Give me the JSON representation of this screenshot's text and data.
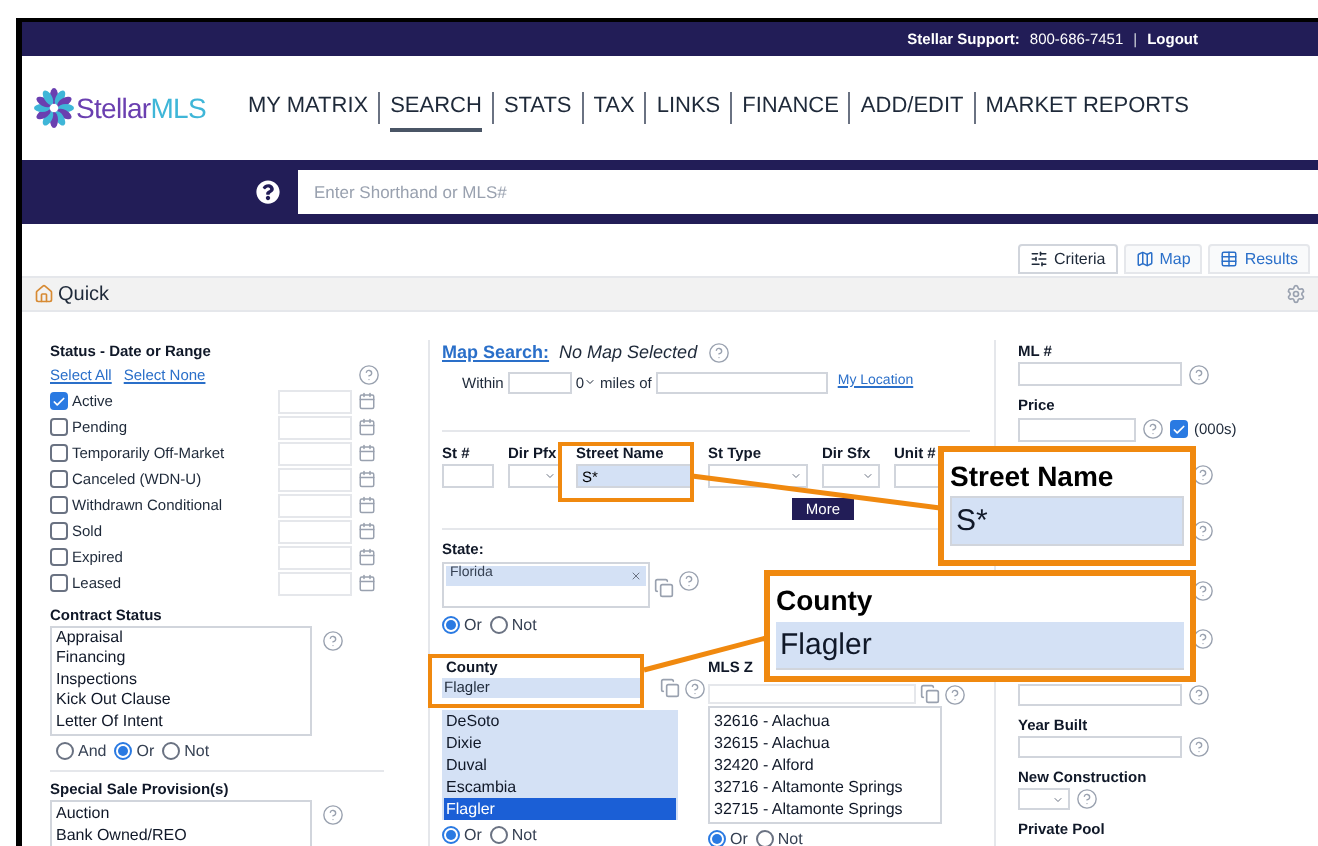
{
  "top_bar": {
    "support_label": "Stellar Support:",
    "phone": "800-686-7451",
    "separator": "|",
    "logout": "Logout"
  },
  "logo": {
    "part_1": "Stellar",
    "part_2": "MLS"
  },
  "nav": [
    {
      "label": "MY MATRIX",
      "selected": false
    },
    {
      "label": "SEARCH",
      "selected": true
    },
    {
      "label": "STATS",
      "selected": false
    },
    {
      "label": "TAX",
      "selected": false
    },
    {
      "label": "LINKS",
      "selected": false
    },
    {
      "label": "FINANCE",
      "selected": false
    },
    {
      "label": "ADD/EDIT",
      "selected": false
    },
    {
      "label": "MARKET REPORTS",
      "selected": false
    }
  ],
  "shorthand": {
    "placeholder": "Enter Shorthand or MLS#"
  },
  "view_tabs": [
    {
      "label": "Criteria",
      "selected": true
    },
    {
      "label": "Map",
      "selected": false
    },
    {
      "label": "Results",
      "selected": false
    }
  ],
  "panel": {
    "title": "Quick"
  },
  "status": {
    "title": "Status - Date or Range",
    "select_all": "Select All",
    "select_none": "Select None",
    "items": [
      {
        "label": "Active",
        "checked": true
      },
      {
        "label": "Pending",
        "checked": false
      },
      {
        "label": "Temporarily Off-Market",
        "checked": false
      },
      {
        "label": "Canceled (WDN-U)",
        "checked": false
      },
      {
        "label": "Withdrawn Conditional",
        "checked": false
      },
      {
        "label": "Sold",
        "checked": false
      },
      {
        "label": "Expired",
        "checked": false
      },
      {
        "label": "Leased",
        "checked": false
      }
    ]
  },
  "contract_status": {
    "title": "Contract Status",
    "options": [
      "Appraisal",
      "Financing",
      "Inspections",
      "Kick Out Clause",
      "Letter Of Intent"
    ],
    "logic": [
      {
        "label": "And",
        "selected": false
      },
      {
        "label": "Or",
        "selected": true
      },
      {
        "label": "Not",
        "selected": false
      }
    ]
  },
  "special_sale": {
    "title": "Special Sale Provision(s)",
    "options": [
      "Auction",
      "Bank Owned/REO"
    ]
  },
  "map_search": {
    "link": "Map Search:",
    "status": "No Map Selected",
    "within": "Within",
    "radius": "0",
    "miles_of": "miles of",
    "my_location": "My Location"
  },
  "address": {
    "fields": [
      {
        "label": "St #",
        "kind": "input"
      },
      {
        "label": "Dir Pfx",
        "kind": "select"
      },
      {
        "label": "Street Name",
        "kind": "input",
        "value": "S*",
        "filled": true
      },
      {
        "label": "St Type",
        "kind": "select"
      },
      {
        "label": "Dir Sfx",
        "kind": "select"
      },
      {
        "label": "Unit #",
        "kind": "input"
      }
    ],
    "more": "More"
  },
  "state": {
    "title": "State:",
    "chips": [
      "Florida"
    ],
    "logic": [
      {
        "label": "Or",
        "selected": true
      },
      {
        "label": "Not",
        "selected": false
      }
    ]
  },
  "county": {
    "title": "County",
    "value": "Flagler",
    "options": [
      {
        "label": "DeSoto",
        "selected": false
      },
      {
        "label": "Dixie",
        "selected": false
      },
      {
        "label": "Duval",
        "selected": false
      },
      {
        "label": "Escambia",
        "selected": false
      },
      {
        "label": "Flagler",
        "selected": true
      }
    ],
    "logic": [
      {
        "label": "Or",
        "selected": true
      },
      {
        "label": "Not",
        "selected": false
      }
    ]
  },
  "zip": {
    "title": "MLS Z",
    "options": [
      "32616 - Alachua",
      "32615 - Alachua",
      "32420 - Alford",
      "32716 - Altamonte Springs",
      "32715 - Altamonte Springs"
    ],
    "logic": [
      {
        "label": "Or",
        "selected": true
      },
      {
        "label": "Not",
        "selected": false
      }
    ]
  },
  "right": {
    "ml_number": "ML #",
    "price": "Price",
    "thousands": {
      "label": "(000s)",
      "checked": true
    },
    "year_built": "Year Built",
    "new_construction": "New Construction",
    "private_pool": "Private Pool"
  },
  "callouts": [
    {
      "title": "Street Name",
      "value": "S*"
    },
    {
      "title": "County",
      "value": "Flagler"
    }
  ]
}
